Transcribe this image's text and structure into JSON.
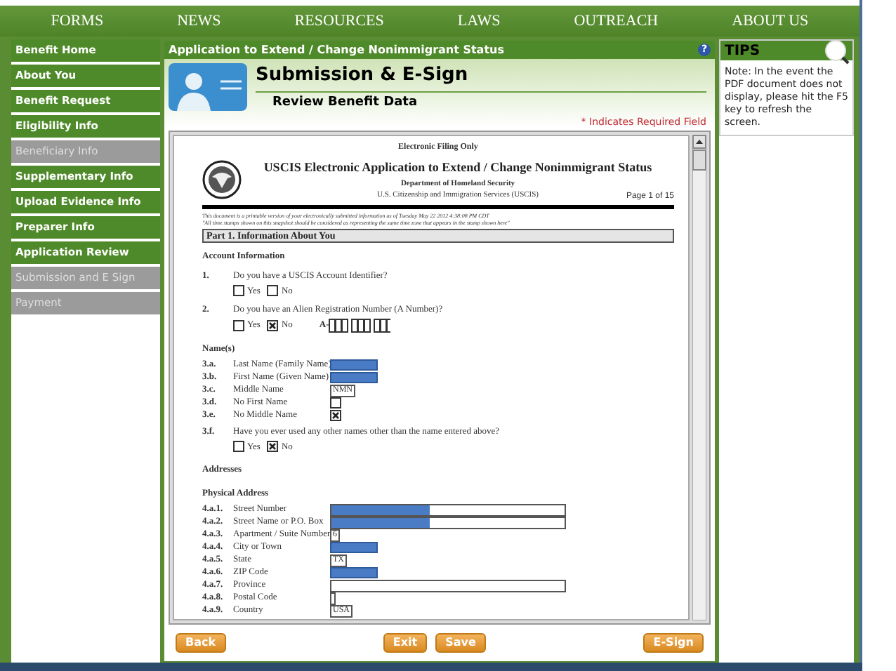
{
  "nav": [
    "FORMS",
    "NEWS",
    "RESOURCES",
    "LAWS",
    "OUTREACH",
    "ABOUT US"
  ],
  "sidebar": {
    "items": [
      {
        "label": "Benefit Home",
        "disabled": false
      },
      {
        "label": "About You",
        "disabled": false
      },
      {
        "label": "Benefit Request",
        "disabled": false
      },
      {
        "label": "Eligibility Info",
        "disabled": false
      },
      {
        "label": "Beneficiary Info",
        "disabled": true
      },
      {
        "label": "Supplementary Info",
        "disabled": false
      },
      {
        "label": "Upload Evidence Info",
        "disabled": false
      },
      {
        "label": "Preparer Info",
        "disabled": false
      },
      {
        "label": "Application Review",
        "disabled": false
      },
      {
        "label": "Submission and E Sign",
        "disabled": true
      },
      {
        "label": "Payment",
        "disabled": true
      }
    ]
  },
  "main": {
    "title": "Application to Extend / Change Nonimmigrant Status",
    "help": "?",
    "heading": "Submission & E-Sign",
    "subheading": "Review Benefit Data",
    "required_note": "* Indicates Required Field"
  },
  "pdf": {
    "filing_note": "Electronic Filing Only",
    "title": "USCIS Electronic Application to Extend / Change Nonimmigrant Status",
    "department": "Department of Homeland Security",
    "agency": "U.S. Citizenship and Immigration Services (USCIS)",
    "page": "Page 1 of 15",
    "timestamp_lines": [
      "This document is a printable version of your electronically submitted information as of    Tuesday May 22 2012  4:38:08 PM CDT",
      "\"All time stamps shown on this snapshot should be considered as representing the same time zone that appears in the stamp shown here\""
    ],
    "part": "Part 1.  Information About You",
    "items": [
      {
        "kind": "heading",
        "text": "Account Information"
      },
      {
        "kind": "question",
        "number": "1.",
        "label": "Do you have a USCIS Account Identifier?",
        "options": [
          {
            "label": "Yes",
            "checked": false
          },
          {
            "label": "No",
            "checked": false
          }
        ]
      },
      {
        "kind": "question",
        "number": "2.",
        "label": "Do you have an Alien Registration Number (A Number)?",
        "options": [
          {
            "label": "Yes",
            "checked": false
          },
          {
            "label": "No",
            "checked": true
          }
        ],
        "a_number_prefix": "A-"
      },
      {
        "kind": "heading",
        "text": "Name(s)"
      },
      {
        "kind": "field",
        "number": "3.a.",
        "label": "Last Name (Family Name)",
        "redacted": true
      },
      {
        "kind": "field",
        "number": "3.b.",
        "label": "First Name (Given Name)",
        "redacted": true
      },
      {
        "kind": "field",
        "number": "3.c.",
        "label": "Middle Name",
        "value": "NMN",
        "redacted": false
      },
      {
        "kind": "checkbox",
        "number": "3.d.",
        "label": "No First Name",
        "checked": false
      },
      {
        "kind": "checkbox",
        "number": "3.e.",
        "label": "No Middle Name",
        "checked": true
      },
      {
        "kind": "question",
        "number": "3.f.",
        "label": "Have you ever used any other names other than the name entered above?",
        "options": [
          {
            "label": "Yes",
            "checked": false
          },
          {
            "label": "No",
            "checked": true
          }
        ]
      },
      {
        "kind": "heading",
        "text": "Addresses"
      },
      {
        "kind": "heading",
        "text": "Physical  Address"
      },
      {
        "kind": "long-field",
        "number": "4.a.1.",
        "label": "Street Number",
        "redacted": true
      },
      {
        "kind": "long-field",
        "number": "4.a.2.",
        "label": "Street Name or P.O. Box",
        "redacted": true
      },
      {
        "kind": "field",
        "number": "4.a.3.",
        "label": "Apartment / Suite Number",
        "value": "6",
        "redacted": false
      },
      {
        "kind": "field",
        "number": "4.a.4.",
        "label": "City or Town",
        "redacted": true
      },
      {
        "kind": "field",
        "number": "4.a.5.",
        "label": "State",
        "value": "TX",
        "redacted": false
      },
      {
        "kind": "field",
        "number": "4.a.6.",
        "label": "ZIP Code",
        "redacted": true
      },
      {
        "kind": "long-field",
        "number": "4.a.7.",
        "label": "Province",
        "redacted": false
      },
      {
        "kind": "field",
        "number": "4.a.8.",
        "label": "Postal Code",
        "redacted": false
      },
      {
        "kind": "field",
        "number": "4.a.9.",
        "label": "Country",
        "value": "USA",
        "redacted": false
      }
    ]
  },
  "buttons": {
    "left": [
      "Back"
    ],
    "center": [
      "Exit",
      "Save"
    ],
    "right": [
      "E-Sign"
    ]
  },
  "tips": {
    "title": "TIPS",
    "text": "Note: In the event the PDF document does not display, please hit the F5 key to refresh the screen."
  }
}
